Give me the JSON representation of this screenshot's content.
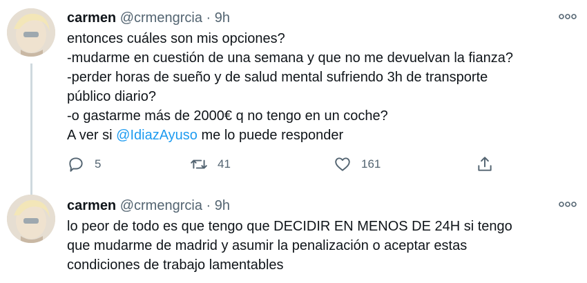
{
  "tweets": [
    {
      "author": {
        "name": "carmen",
        "handle": "@crmengrcia"
      },
      "separator": "·",
      "time": "9h",
      "lines": [
        "entonces cuáles son mis opciones?",
        "-mudarme en cuestión de una semana y que no me devuelvan la fianza?",
        "-perder horas de sueño y de salud mental sufriendo 3h de transporte",
        "público diario?",
        "-o gastarme más de 2000€ q no tengo en un coche?"
      ],
      "last_line": {
        "before": "A ver si ",
        "mention": "@IdiazAyuso",
        "after": " me lo puede responder"
      },
      "stats": {
        "replies": "5",
        "retweets": "41",
        "likes": "161"
      }
    },
    {
      "author": {
        "name": "carmen",
        "handle": "@crmengrcia"
      },
      "separator": "·",
      "time": "9h",
      "lines": [
        "lo peor de todo es que tengo que DECIDIR EN MENOS DE 24H si tengo",
        "que mudarme de madrid y asumir la penalización o aceptar estas",
        "condiciones de trabajo lamentables"
      ]
    }
  ],
  "colors": {
    "text": "#0f1419",
    "muted": "#536471",
    "link": "#1d9bf0"
  },
  "icons": [
    "avatar",
    "more-icon",
    "reply-icon",
    "retweet-icon",
    "like-icon",
    "share-icon"
  ]
}
